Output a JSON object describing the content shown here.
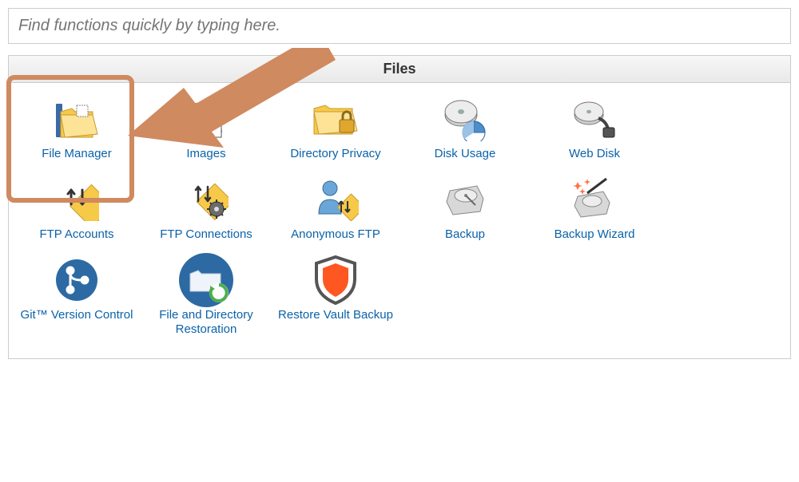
{
  "search": {
    "placeholder": "Find functions quickly by typing here."
  },
  "panel": {
    "title": "Files",
    "items": [
      {
        "name": "file-manager",
        "label": "File Manager",
        "icon": "folder-app"
      },
      {
        "name": "images",
        "label": "Images",
        "icon": "photo-stack"
      },
      {
        "name": "directory-privacy",
        "label": "Directory Privacy",
        "icon": "folder-lock"
      },
      {
        "name": "disk-usage",
        "label": "Disk Usage",
        "icon": "disk-pie"
      },
      {
        "name": "web-disk",
        "label": "Web Disk",
        "icon": "disk-net"
      },
      {
        "name": "ftp-accounts",
        "label": "FTP Accounts",
        "icon": "ftp-arrows"
      },
      {
        "name": "ftp-connections",
        "label": "FTP Connections",
        "icon": "ftp-gear"
      },
      {
        "name": "anonymous-ftp",
        "label": "Anonymous FTP",
        "icon": "user-ftp"
      },
      {
        "name": "backup",
        "label": "Backup",
        "icon": "hdd"
      },
      {
        "name": "backup-wizard",
        "label": "Backup Wizard",
        "icon": "hdd-wand"
      },
      {
        "name": "git-version-control",
        "label": "Git™ Version Control",
        "icon": "git-graph"
      },
      {
        "name": "file-dir-restore",
        "label": "File and Directory Restoration",
        "icon": "folder-restore"
      },
      {
        "name": "restore-vault",
        "label": "Restore Vault Backup",
        "icon": "vault-shield"
      }
    ]
  }
}
